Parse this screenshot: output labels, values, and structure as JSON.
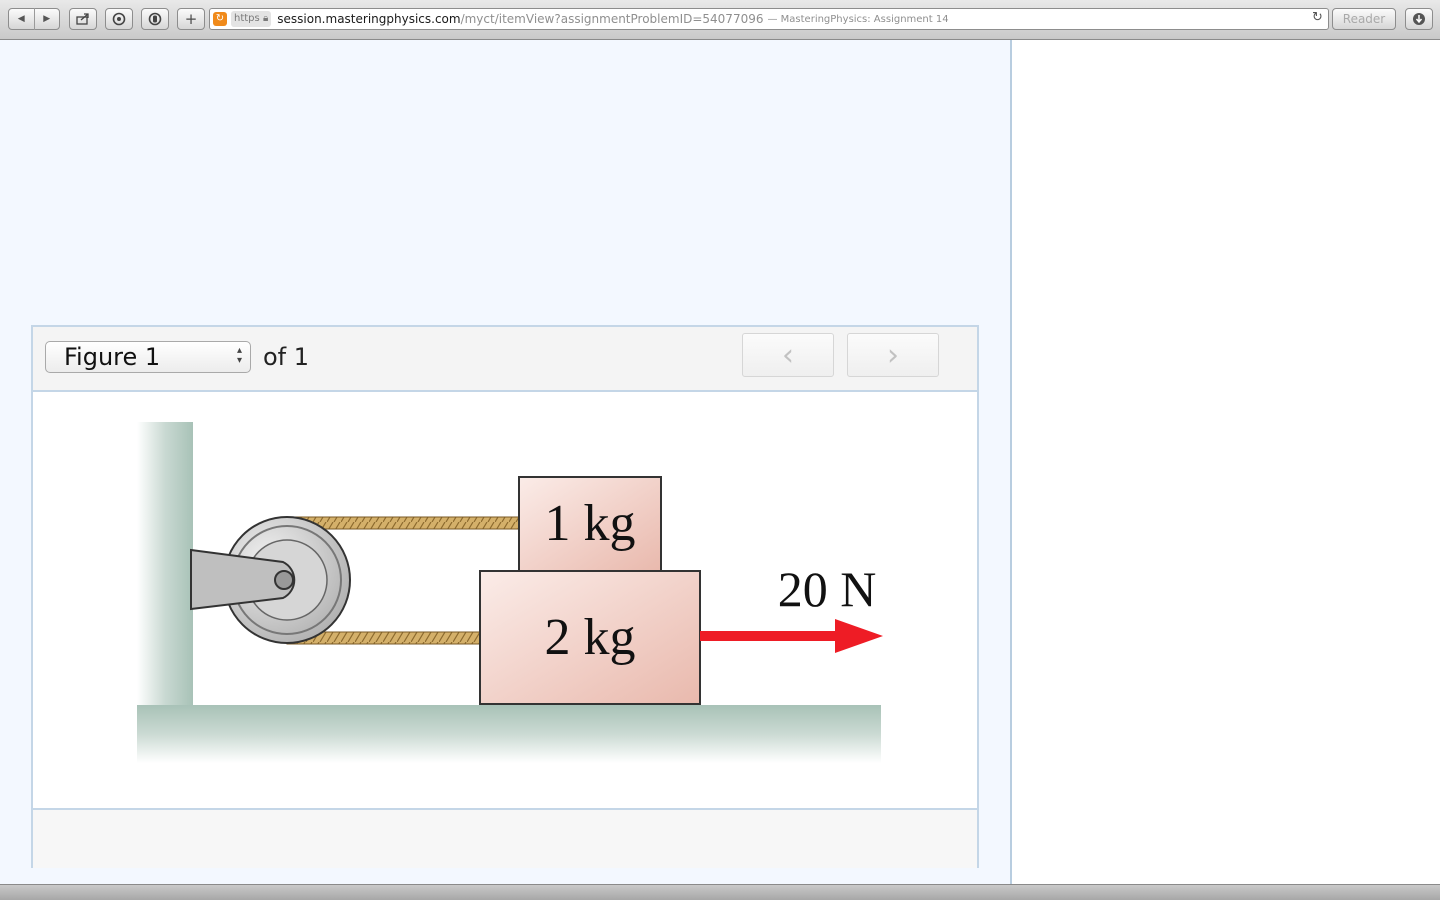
{
  "toolbar": {
    "url_scheme": "https",
    "url_host": "session.masteringphysics.com",
    "url_path": "/myct/itemView?assignmentProblemID=54077096",
    "page_title": "— MasteringPhysics: Assignment 14",
    "reader_label": "Reader",
    "back_glyph": "◀",
    "forward_glyph": "▶",
    "add_glyph": "+",
    "reload_glyph": "↻"
  },
  "figure": {
    "select_value": "Figure 1",
    "of_label": "of 1",
    "prev_glyph": "‹",
    "next_glyph": "›",
    "block_top_label": "1 kg",
    "block_bottom_label": "2 kg",
    "force_label": "20 N"
  },
  "colors": {
    "force_arrow": "#ee1c25",
    "block_fill": "#f2d4cd",
    "rope": "#c9a45c",
    "panel_border": "#c4d6e7",
    "page_bg": "#f3f8ff"
  }
}
